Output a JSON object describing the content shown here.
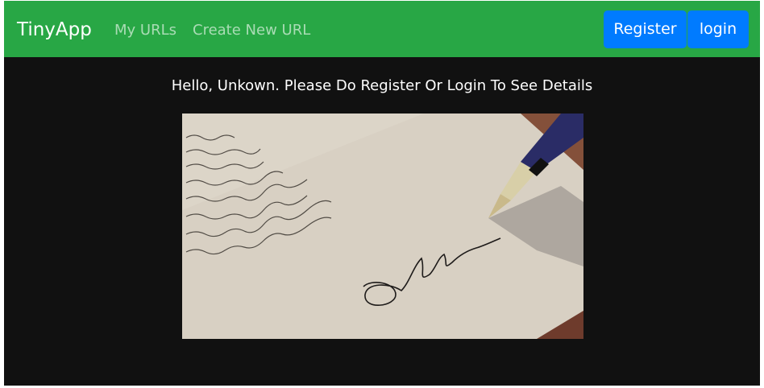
{
  "navbar": {
    "brand": "TinyApp",
    "links": [
      {
        "label": "My URLs"
      },
      {
        "label": "Create New URL"
      }
    ],
    "buttons": {
      "register": "Register",
      "login": "login"
    }
  },
  "main": {
    "greeting": "Hello, Unkown. Please Do Register Or Login To See Details"
  },
  "colors": {
    "navbar_bg": "#28a745",
    "button_bg": "#007bff",
    "page_bg": "#111111"
  }
}
